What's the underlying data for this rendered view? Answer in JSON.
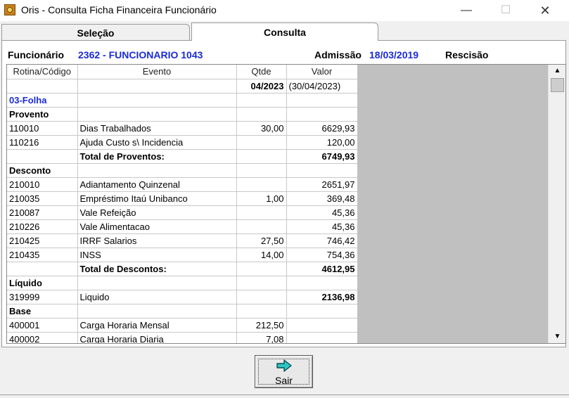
{
  "window": {
    "title": "Oris - Consulta Ficha Financeira Funcionário"
  },
  "tabs": {
    "selecao": "Seleção",
    "consulta": "Consulta"
  },
  "header": {
    "funcionario_label": "Funcionário",
    "funcionario_value": "2362 - FUNCIONARIO 1043",
    "admissao_label": "Admissão",
    "admissao_value": "18/03/2019",
    "rescisao_label": "Rescisão"
  },
  "grid": {
    "columns": [
      "Rotina/Código",
      "Evento",
      "Qtde",
      "Valor"
    ],
    "period": {
      "qtde": "04/2023",
      "valor": "(30/04/2023)"
    },
    "rows": [
      {
        "code": "03-Folha",
        "event": "",
        "qtde": "",
        "valor": ""
      },
      {
        "code": "Provento",
        "event": "",
        "qtde": "",
        "valor": ""
      },
      {
        "code": "110010",
        "event": "Dias Trabalhados",
        "qtde": "30,00",
        "valor": "6629,93"
      },
      {
        "code": "110216",
        "event": "Ajuda Custo s\\ Incidencia",
        "qtde": "",
        "valor": "120,00"
      },
      {
        "code": "",
        "event": "Total de Proventos:",
        "qtde": "",
        "valor": "6749,93"
      },
      {
        "code": "Desconto",
        "event": "",
        "qtde": "",
        "valor": ""
      },
      {
        "code": "210010",
        "event": "Adiantamento Quinzenal",
        "qtde": "",
        "valor": "2651,97"
      },
      {
        "code": "210035",
        "event": "Empréstimo Itaú Unibanco",
        "qtde": "1,00",
        "valor": "369,48"
      },
      {
        "code": "210087",
        "event": "Vale Refeição",
        "qtde": "",
        "valor": "45,36"
      },
      {
        "code": "210226",
        "event": "Vale Alimentacao",
        "qtde": "",
        "valor": "45,36"
      },
      {
        "code": "210425",
        "event": "IRRF Salarios",
        "qtde": "27,50",
        "valor": "746,42"
      },
      {
        "code": "210435",
        "event": "INSS",
        "qtde": "14,00",
        "valor": "754,36"
      },
      {
        "code": "",
        "event": "Total de Descontos:",
        "qtde": "",
        "valor": "4612,95"
      },
      {
        "code": "Líquido",
        "event": "",
        "qtde": "",
        "valor": ""
      },
      {
        "code": "319999",
        "event": "Liquido",
        "qtde": "",
        "valor": "2136,98"
      },
      {
        "code": "Base",
        "event": "",
        "qtde": "",
        "valor": ""
      },
      {
        "code": "400001",
        "event": "Carga Horaria Mensal",
        "qtde": "212,50",
        "valor": ""
      },
      {
        "code": "400002",
        "event": "Carga Horaria Diaria",
        "qtde": "7,08",
        "valor": ""
      }
    ]
  },
  "buttons": {
    "sair": "Sair"
  },
  "icons": {
    "app": "oris-app-icon",
    "exit": "arrow-right-icon"
  },
  "colors": {
    "accent_blue": "#1a2ad8",
    "grid_grey": "#c0c0c0"
  }
}
